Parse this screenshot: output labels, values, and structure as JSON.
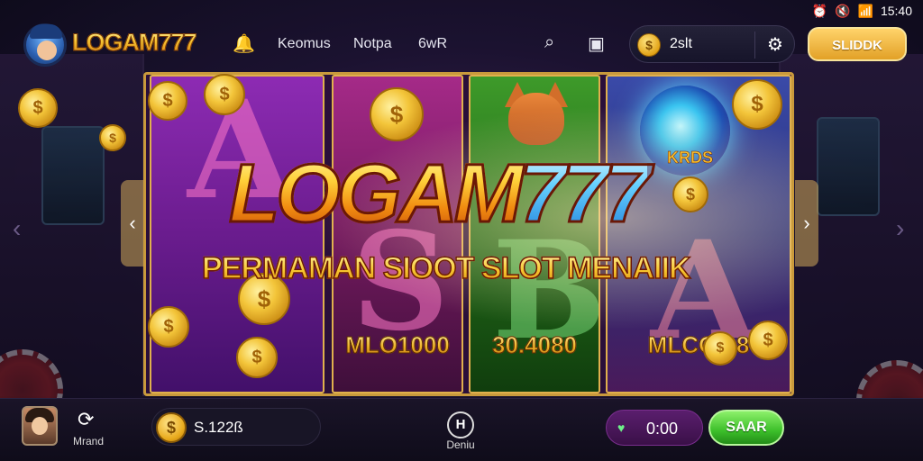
{
  "status_bar": {
    "time": "15:40",
    "icons": [
      "alarm-icon",
      "mute-icon",
      "wifi-icon",
      "signal-icon"
    ]
  },
  "header": {
    "logo_text": "LOGAM777",
    "nav_icon": "bell-icon",
    "nav_items": [
      "Keomus",
      "Notpa",
      "6wR"
    ],
    "search_icon": "search-icon",
    "wallet_icon": "wallet-icon",
    "coin_balance": "2slt",
    "settings_icon": "gear-icon",
    "action_button": "SLIDDK"
  },
  "banner": {
    "headline_main": "LOGAM",
    "headline_accent": "777",
    "subheadline": "PERMAMAN SIOOT SLOT MENAIIK",
    "corner_tag": "KRDS",
    "panels": [
      {
        "id": "panel-purple",
        "value": ""
      },
      {
        "id": "panel-magenta",
        "value": "MLO1000"
      },
      {
        "id": "panel-green",
        "value": "30.4080"
      },
      {
        "id": "panel-blue",
        "value": "MLCO.08"
      }
    ],
    "prev_arrow": "‹",
    "next_arrow": "›"
  },
  "footer": {
    "player_label": "Mrand",
    "balance": "S.122ß",
    "home_label": "Deniu",
    "home_glyph": "H",
    "timer_value": "0:00",
    "confirm_button": "SAAR"
  },
  "colors": {
    "gold": "#f3c53a",
    "accent_blue": "#67d1ff",
    "confirm_green": "#3cbf2a",
    "frame_gold": "#c99a3c"
  }
}
